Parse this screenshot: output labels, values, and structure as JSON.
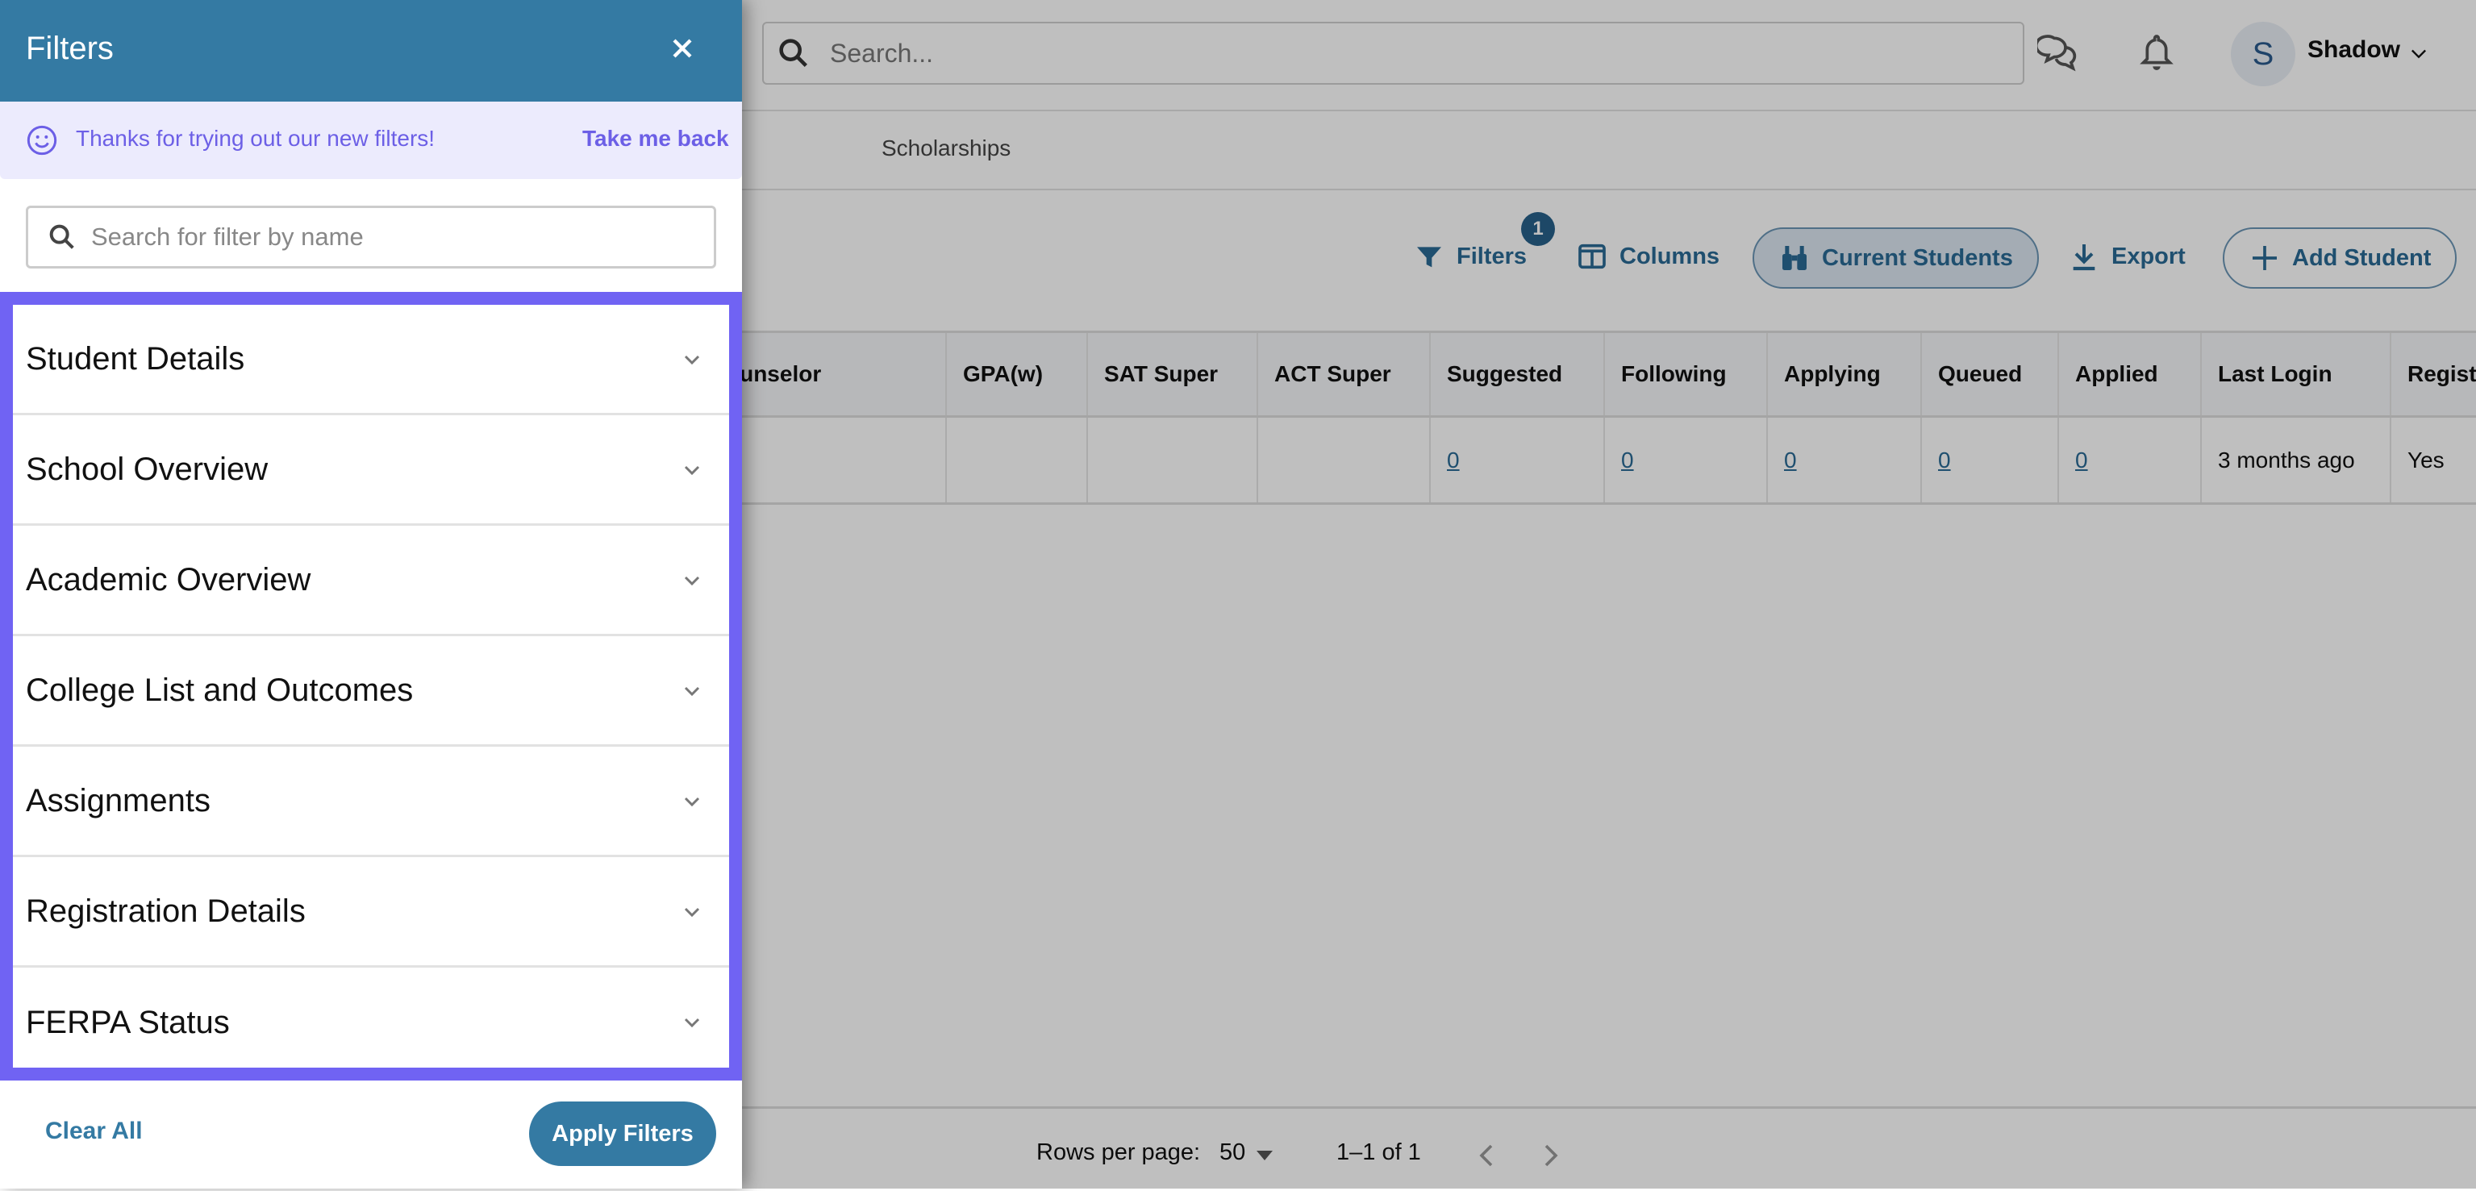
{
  "topbar": {
    "search_placeholder": "Search...",
    "user": {
      "initial": "S",
      "name": "Shadow"
    }
  },
  "subnav": {
    "visible_item": "Scholarships"
  },
  "toolbar": {
    "filters_label": "Filters",
    "filters_badge": "1",
    "columns_label": "Columns",
    "current_students_label": "Current Students",
    "export_label": "Export",
    "add_student_label": "Add Student"
  },
  "table": {
    "columns": [
      "ounselor",
      "GPA(w)",
      "SAT Super",
      "ACT Super",
      "Suggested",
      "Following",
      "Applying",
      "Queued",
      "Applied",
      "Last Login",
      "Regist"
    ],
    "rows": [
      {
        "counselor": "",
        "gpa_w": "",
        "sat_super": "",
        "act_super": "",
        "suggested": "0",
        "following": "0",
        "applying": "0",
        "queued": "0",
        "applied": "0",
        "last_login": "3 months ago",
        "registered": "Yes"
      }
    ]
  },
  "pagination": {
    "rows_per_page_label": "Rows per page:",
    "rows_per_page_value": "50",
    "range": "1–1 of 1"
  },
  "drawer": {
    "title": "Filters",
    "notice": {
      "message": "Thanks for trying out our new filters!",
      "link": "Take me back"
    },
    "search_placeholder": "Search for filter by name",
    "sections": [
      {
        "label": "Student Details"
      },
      {
        "label": "School Overview"
      },
      {
        "label": "Academic Overview"
      },
      {
        "label": "College List and Outcomes"
      },
      {
        "label": "Assignments"
      },
      {
        "label": "Registration Details"
      },
      {
        "label": "FERPA Status"
      }
    ],
    "clear_label": "Clear All",
    "apply_label": "Apply Filters"
  },
  "colors": {
    "drawer_header": "#347aa3",
    "notice_bg": "#ecebfd",
    "notice_text": "#6c5fe6",
    "highlight_border": "#7063f3",
    "link": "#2a6a94"
  }
}
